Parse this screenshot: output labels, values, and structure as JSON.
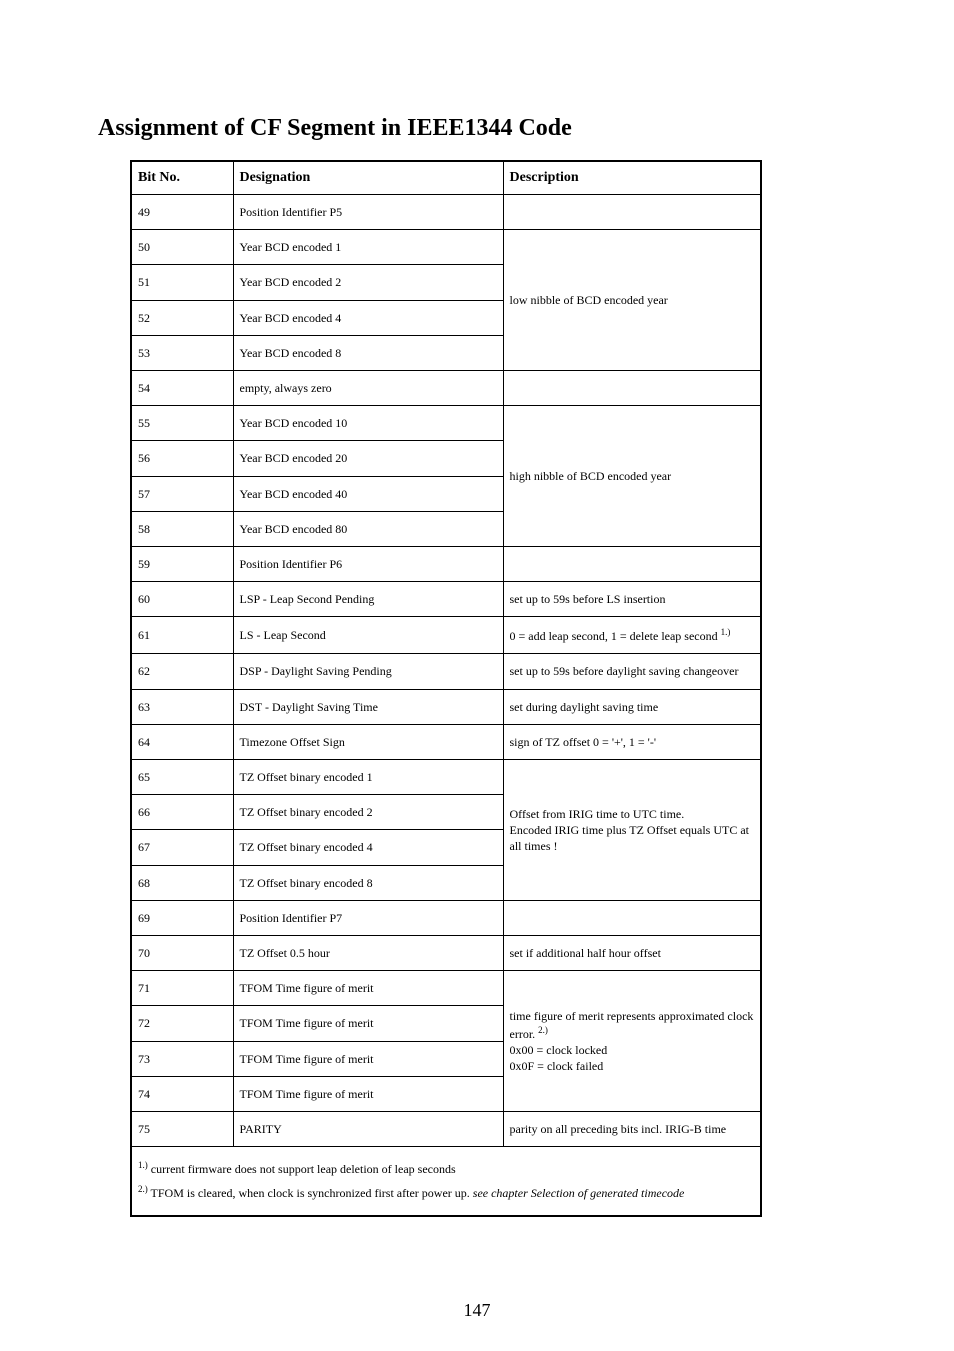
{
  "title": "Assignment of CF Segment in IEEE1344 Code",
  "header": {
    "bitno": "Bit No.",
    "designation": "Designation",
    "description": "Description"
  },
  "rows": [
    {
      "bit": "49",
      "des": "Position Identifier P5"
    },
    {
      "bit": "50",
      "des": "Year BCD encoded 1"
    },
    {
      "bit": "51",
      "des": "Year BCD encoded 2"
    },
    {
      "bit": "52",
      "des": "Year BCD encoded 4"
    },
    {
      "bit": "53",
      "des": "Year BCD encoded 8"
    },
    {
      "bit": "54",
      "des": "empty, always zero"
    },
    {
      "bit": "55",
      "des": "Year BCD encoded 10"
    },
    {
      "bit": "56",
      "des": "Year BCD encoded 20"
    },
    {
      "bit": "57",
      "des": "Year BCD encoded 40"
    },
    {
      "bit": "58",
      "des": "Year BCD encoded 80"
    },
    {
      "bit": "59",
      "des": "Position Identifier P6"
    },
    {
      "bit": "60",
      "des": "LSP - Leap Second Pending"
    },
    {
      "bit": "61",
      "des": "LS - Leap Second"
    },
    {
      "bit": "62",
      "des": "DSP - Daylight Saving Pending"
    },
    {
      "bit": "63",
      "des": "DST - Daylight Saving Time"
    },
    {
      "bit": "64",
      "des": "Timezone Offset Sign"
    },
    {
      "bit": "65",
      "des": "TZ Offset binary encoded 1"
    },
    {
      "bit": "66",
      "des": "TZ Offset binary encoded 2"
    },
    {
      "bit": "67",
      "des": "TZ Offset binary encoded 4"
    },
    {
      "bit": "68",
      "des": "TZ Offset binary encoded 8"
    },
    {
      "bit": "69",
      "des": "Position Identifier P7"
    },
    {
      "bit": "70",
      "des": "TZ Offset 0.5 hour"
    },
    {
      "bit": "71",
      "des": "TFOM Time figure of merit"
    },
    {
      "bit": "72",
      "des": "TFOM Time figure of merit"
    },
    {
      "bit": "73",
      "des": "TFOM Time figure of merit"
    },
    {
      "bit": "74",
      "des": "TFOM Time figure of merit"
    },
    {
      "bit": "75",
      "des": "PARITY"
    }
  ],
  "desc": {
    "low_nibble": "low nibble of BCD encoded year",
    "high_nibble": "high nibble of BCD encoded year",
    "lsp": "set up to 59s before LS insertion",
    "ls_pre": "0 = add leap second, 1 = delete leap second ",
    "ls_sup": "1.)",
    "dsp": "set up to 59s before daylight saving changeover",
    "dst": "set during daylight saving time",
    "tz_sign": "sign of TZ offset 0 = '+', 1  = '-'",
    "tz_off_l1": "Offset from IRIG time to UTC time.",
    "tz_off_l2": "Encoded IRIG time plus TZ Offset equals UTC at all times !",
    "tz_half": "set if additional half hour offset",
    "tfom_l1": "time figure of merit represents approximated clock error. ",
    "tfom_sup": "2.)",
    "tfom_l2": "0x00 = clock locked",
    "tfom_l3": "0x0F = clock failed",
    "parity": "parity on all preceding bits incl. IRIG-B time"
  },
  "foot": {
    "sup1": "1.)",
    "note1": " current firmware does not support leap deletion of leap seconds",
    "sup2": "2.)",
    "note2_a": " TFOM is cleared, when clock is synchronized first after power up. ",
    "note2_b": "see chapter Selection of generated timecode"
  },
  "pagenum": "147"
}
